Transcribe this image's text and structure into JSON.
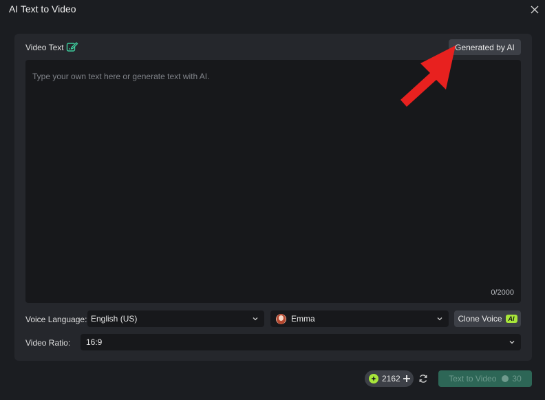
{
  "window": {
    "title": "AI Text to Video"
  },
  "video_text": {
    "label": "Video Text",
    "generate_button": "Generated by AI",
    "placeholder": "Type your own text here or generate text with AI.",
    "counter": "0/2000"
  },
  "voice": {
    "language_label": "Voice Language:",
    "language_value": "English (US)",
    "voice_name": "Emma",
    "clone_button": "Clone Voice",
    "clone_badge": "AI"
  },
  "ratio": {
    "label": "Video Ratio:",
    "value": "16:9"
  },
  "footer": {
    "credits": "2162",
    "submit_label": "Text to Video",
    "submit_cost": "30"
  },
  "colors": {
    "accent_green": "#a8e63a",
    "annotation_arrow": "#e8211f",
    "submit_bg": "#2d6656"
  },
  "icons": [
    "close-icon",
    "edit-icon",
    "chevron-down-icon",
    "avatar",
    "coin-icon",
    "plus-icon",
    "refresh-icon",
    "arrow-annotation"
  ]
}
